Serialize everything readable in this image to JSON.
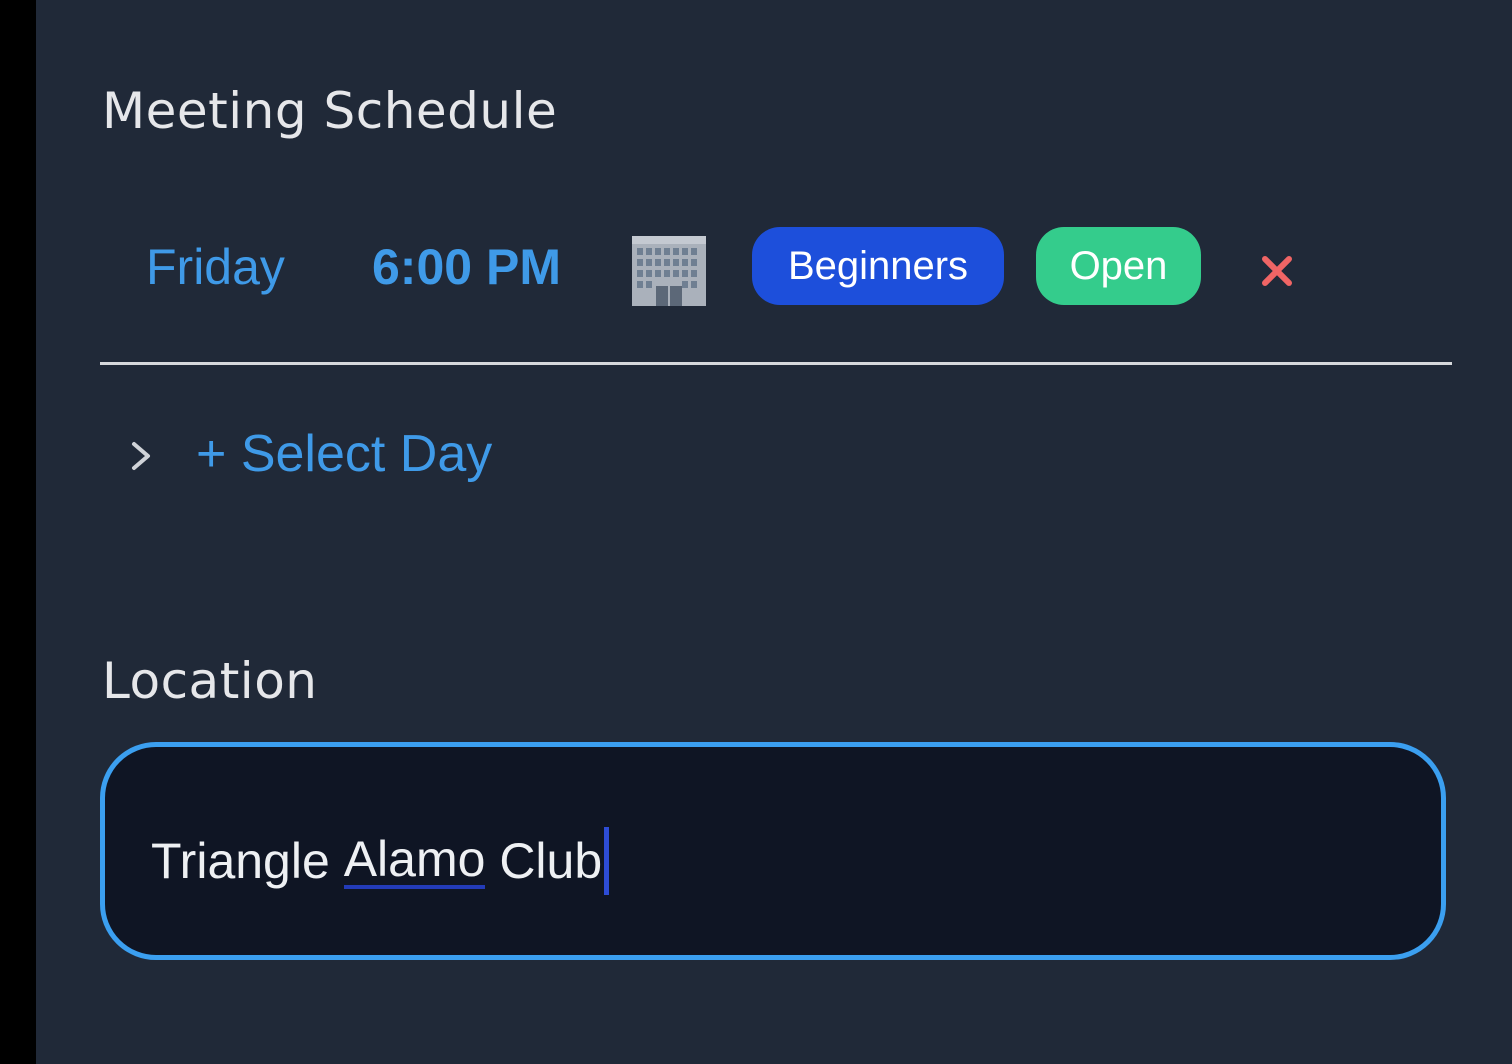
{
  "meeting_schedule": {
    "title": "Meeting Schedule",
    "entries": [
      {
        "day": "Friday",
        "time": "6:00 PM",
        "venue_icon": "office-building-icon",
        "tags": [
          "Beginners",
          "Open"
        ],
        "remove_icon": "close-icon"
      }
    ],
    "add_day_label": "+ Select Day"
  },
  "location": {
    "title": "Location",
    "input": {
      "parts": [
        "Triangle ",
        "Alamo",
        " Club"
      ]
    }
  },
  "colors": {
    "background": "#202938",
    "accent": "#3f9ae8",
    "beginners_tag": "#1d4fdb",
    "open_tag": "#34cc8c",
    "remove": "#f06565",
    "input_border": "#3b9ff0"
  }
}
